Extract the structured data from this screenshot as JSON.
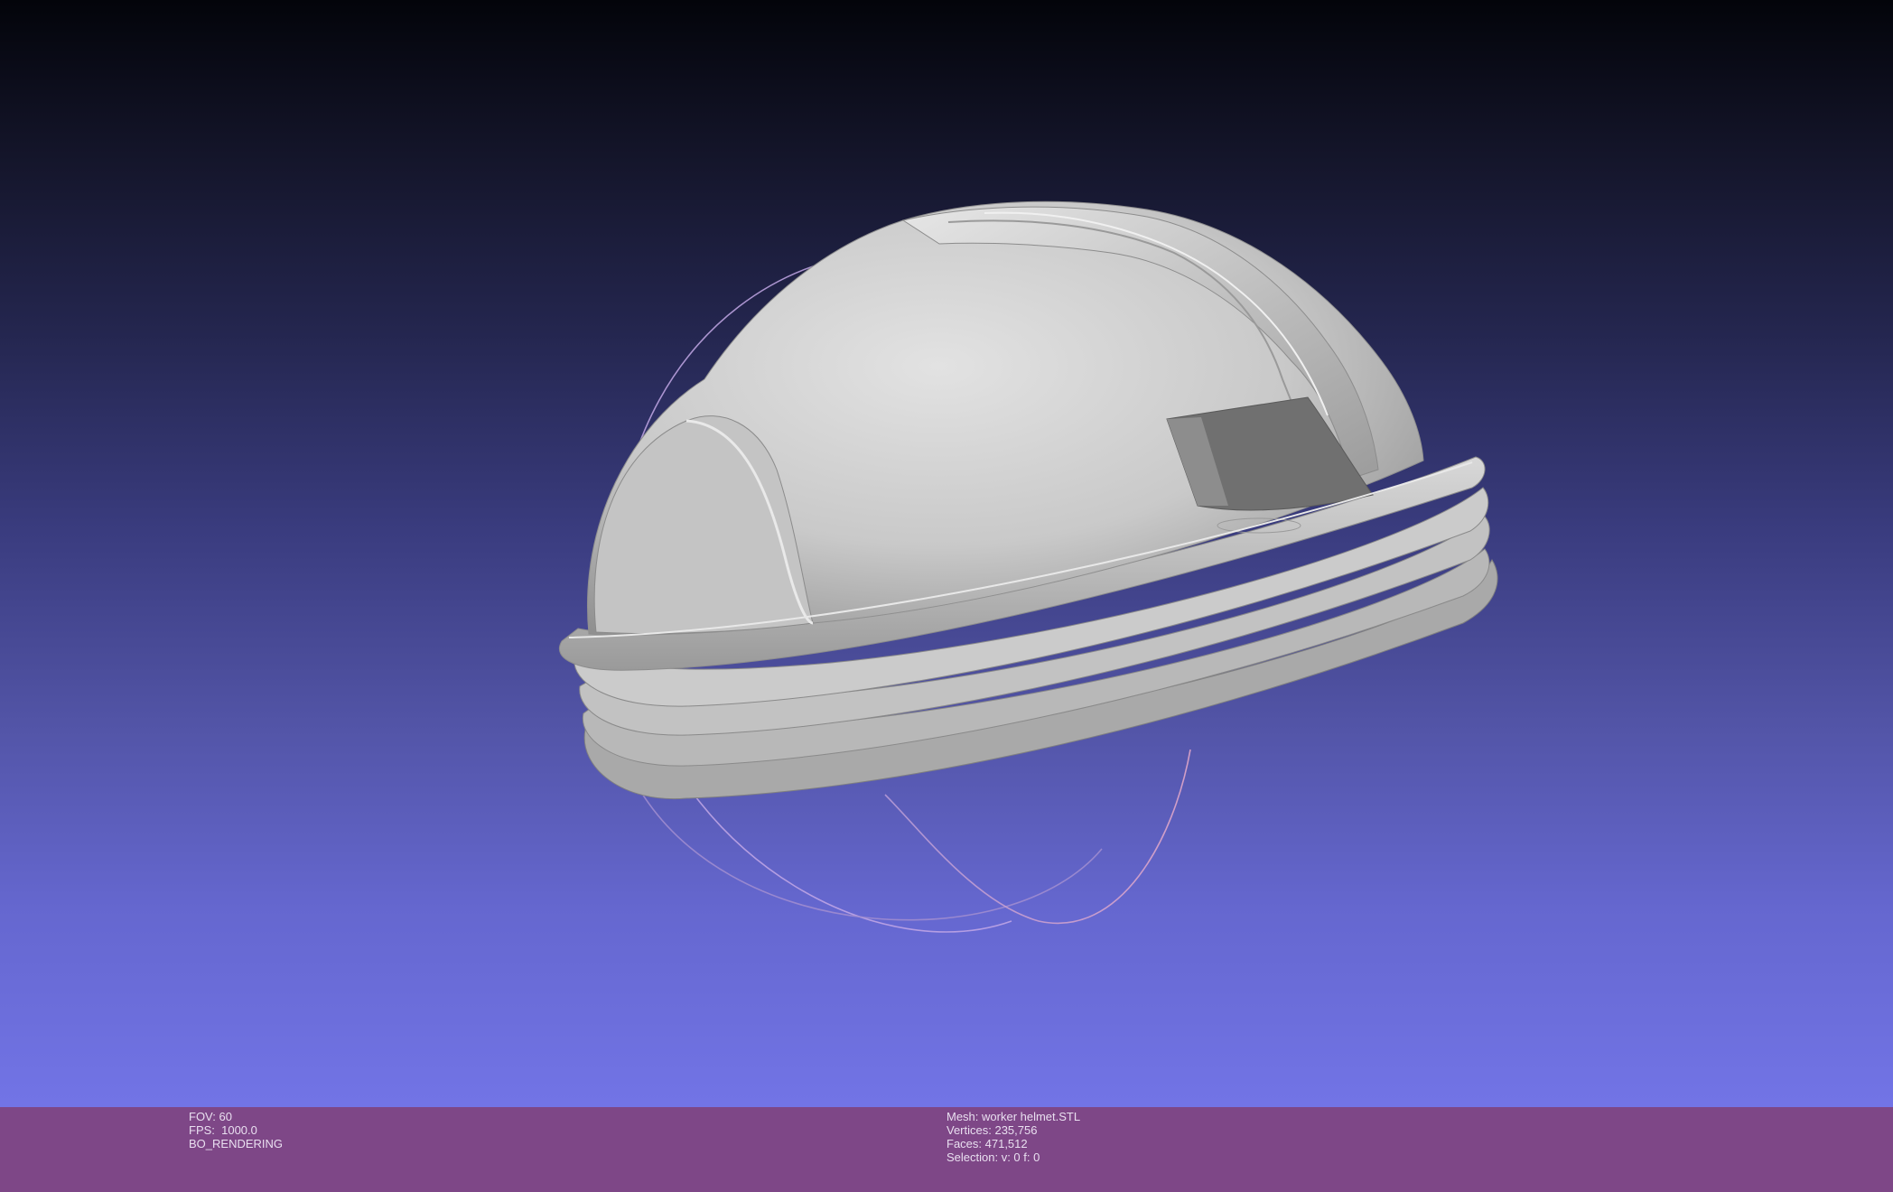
{
  "viewer": {
    "left_info": {
      "fov": "FOV: 60",
      "fps": "FPS:  1000.0",
      "mode": "BO_RENDERING"
    },
    "right_info": {
      "mesh": "Mesh: worker helmet.STL",
      "vertices": "Vertices: 235,756",
      "faces": "Faces: 471,512",
      "selection": "Selection: v: 0 f: 0"
    }
  },
  "colors": {
    "background_top": "#03040a",
    "background_bottom": "#7274e6",
    "status_bar": "#7e4787",
    "status_text": "#e9dff0",
    "model_base": "#c8c8c8",
    "trackball_ring": "#c7a6e0"
  },
  "icons": {
    "trackball": "trackball-gizmo",
    "model": "helmet-mesh"
  }
}
